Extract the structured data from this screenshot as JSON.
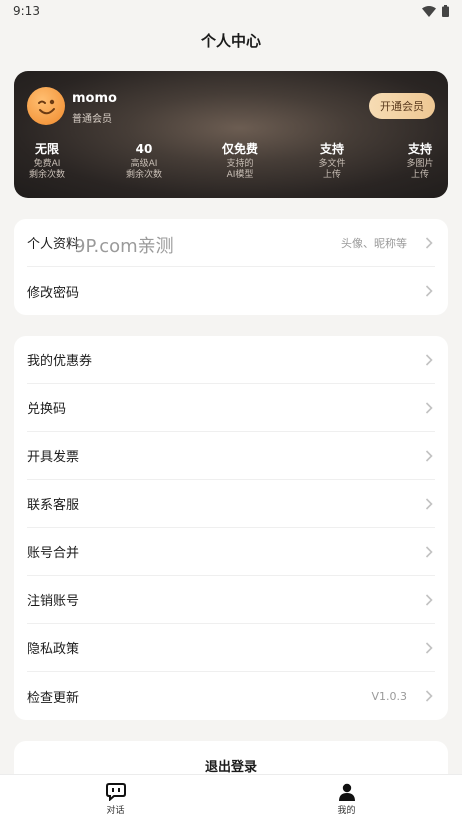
{
  "status_bar": {
    "time": "9:13"
  },
  "header": {
    "title": "个人中心"
  },
  "profile": {
    "username": "momo",
    "member_level": "普通会员",
    "open_vip_label": "开通会员",
    "benefits": [
      {
        "title": "无限",
        "sub1": "免费AI",
        "sub2": "剩余次数"
      },
      {
        "title": "40",
        "sub1": "高级AI",
        "sub2": "剩余次数"
      },
      {
        "title": "仅免费",
        "sub1": "支持的",
        "sub2": "AI模型"
      },
      {
        "title": "支持",
        "sub1": "多文件",
        "sub2": "上传"
      },
      {
        "title": "支持",
        "sub1": "多图片",
        "sub2": "上传"
      }
    ]
  },
  "account_section": {
    "items": [
      {
        "label": "个人资料",
        "value": "头像、昵称等"
      },
      {
        "label": "修改密码",
        "value": ""
      }
    ]
  },
  "services_section": {
    "items": [
      {
        "label": "我的优惠券",
        "value": ""
      },
      {
        "label": "兑换码",
        "value": ""
      },
      {
        "label": "开具发票",
        "value": ""
      },
      {
        "label": "联系客服",
        "value": ""
      },
      {
        "label": "账号合并",
        "value": ""
      },
      {
        "label": "注销账号",
        "value": ""
      },
      {
        "label": "隐私政策",
        "value": ""
      },
      {
        "label": "检查更新",
        "value": "V1.0.3"
      }
    ]
  },
  "logout_label": "退出登录",
  "watermark": "9P.com亲测",
  "tabbar": {
    "tabs": [
      {
        "label": "对话",
        "icon": "chat-icon"
      },
      {
        "label": "我的",
        "icon": "user-icon"
      }
    ]
  }
}
